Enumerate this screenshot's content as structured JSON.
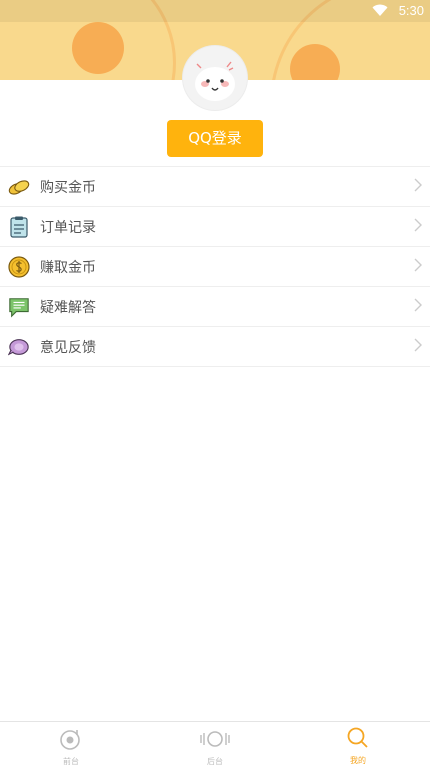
{
  "status_bar": {
    "time": "5:30"
  },
  "login": {
    "label": "QQ登录"
  },
  "menu": {
    "items": [
      {
        "label": "购买金币",
        "icon": "coins-icon"
      },
      {
        "label": "订单记录",
        "icon": "clipboard-icon"
      },
      {
        "label": "赚取金币",
        "icon": "dollar-coin-icon"
      },
      {
        "label": "疑难解答",
        "icon": "chat-bubble-icon"
      },
      {
        "label": "意见反馈",
        "icon": "feedback-icon"
      }
    ]
  },
  "tabbar": {
    "tabs": [
      {
        "label": "前台",
        "active": false
      },
      {
        "label": "后台",
        "active": false
      },
      {
        "label": "我的",
        "active": true
      }
    ]
  },
  "colors": {
    "accent": "#ffb30d",
    "header": "#f9d98d",
    "tab_active": "#f5a623",
    "tab_inactive": "#bbbbbb"
  }
}
